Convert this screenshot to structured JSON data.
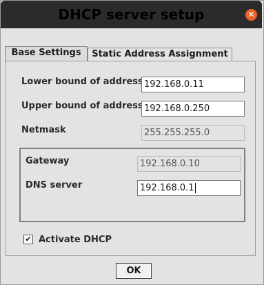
{
  "window": {
    "title": "DHCP server setup",
    "close_icon": "close-icon"
  },
  "tabs": [
    {
      "label": "Base Settings",
      "active": true
    },
    {
      "label": "Static Address Assignment",
      "active": false
    }
  ],
  "form": {
    "lower_bound_label": "Lower bound of address",
    "lower_bound_value": "192.168.0.11",
    "upper_bound_label": "Upper bound of address",
    "upper_bound_value": "192.168.0.250",
    "netmask_label": "Netmask",
    "netmask_value": "255.255.255.0",
    "gateway_label": "Gateway",
    "gateway_value": "192.168.0.10",
    "dns_label": "DNS server",
    "dns_value": "192.168.0.1",
    "activate_label": "Activate DHCP",
    "activate_checked": true,
    "check_mark": "✔"
  },
  "footer": {
    "ok_label": "OK"
  },
  "colors": {
    "titlebar": "#2b2b2b",
    "close_button": "#e8632a",
    "dialog_bg": "#e3e3e3"
  }
}
